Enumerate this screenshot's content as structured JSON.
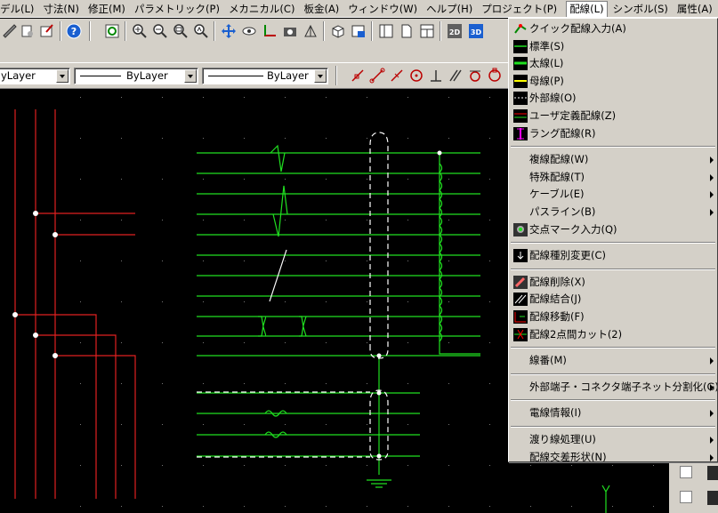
{
  "menubar": {
    "items": [
      {
        "label": "デル(L)"
      },
      {
        "label": "寸法(N)"
      },
      {
        "label": "修正(M)"
      },
      {
        "label": "パラメトリック(P)"
      },
      {
        "label": "メカニカル(C)"
      },
      {
        "label": "板金(A)"
      },
      {
        "label": "ウィンドウ(W)"
      },
      {
        "label": "ヘルプ(H)"
      },
      {
        "label": "プロジェクト(P)"
      },
      {
        "label": "配線(L)"
      },
      {
        "label": "シンボル(S)"
      },
      {
        "label": "属性(A)"
      }
    ]
  },
  "toolbar": {
    "layer_combo": "yLayer",
    "linetype_combo": "ByLayer",
    "lineweight_combo": "ByLayer",
    "btn_2d": "2D",
    "btn_3d": "3D"
  },
  "dropdown": {
    "groups": [
      [
        {
          "label": "クイック配線入力(A)",
          "icon": "quick-wire-icon",
          "submenu": false
        },
        {
          "label": "標準(S)",
          "icon": "standard-wire-icon",
          "submenu": false
        },
        {
          "label": "太線(L)",
          "icon": "thick-wire-icon",
          "submenu": false
        },
        {
          "label": "母線(P)",
          "icon": "bus-wire-icon",
          "submenu": false
        },
        {
          "label": "外部線(O)",
          "icon": "external-wire-icon",
          "submenu": false
        },
        {
          "label": "ユーザ定義配線(Z)",
          "icon": "user-wire-icon",
          "submenu": false
        },
        {
          "label": "ラング配線(R)",
          "icon": "rung-wire-icon",
          "submenu": false
        }
      ],
      [
        {
          "label": "複線配線(W)",
          "icon": "",
          "submenu": true
        },
        {
          "label": "特殊配線(T)",
          "icon": "",
          "submenu": true
        },
        {
          "label": "ケーブル(E)",
          "icon": "",
          "submenu": true
        },
        {
          "label": "パスライン(B)",
          "icon": "",
          "submenu": true
        },
        {
          "label": "交点マーク入力(Q)",
          "icon": "junction-mark-icon",
          "submenu": false
        }
      ],
      [
        {
          "label": "配線種別変更(C)",
          "icon": "wire-type-change-icon",
          "submenu": false
        }
      ],
      [
        {
          "label": "配線削除(X)",
          "icon": "wire-delete-icon",
          "submenu": false
        },
        {
          "label": "配線結合(J)",
          "icon": "wire-join-icon",
          "submenu": false
        },
        {
          "label": "配線移動(F)",
          "icon": "wire-move-icon",
          "submenu": false
        },
        {
          "label": "配線2点間カット(2)",
          "icon": "wire-cut-icon",
          "submenu": false
        }
      ],
      [
        {
          "label": "線番(M)",
          "icon": "",
          "submenu": true
        }
      ],
      [
        {
          "label": "外部端子・コネクタ端子ネット分割化(G)",
          "icon": "",
          "submenu": true
        }
      ],
      [
        {
          "label": "電線情報(I)",
          "icon": "",
          "submenu": true
        }
      ],
      [
        {
          "label": "渡り線処理(U)",
          "icon": "",
          "submenu": true
        },
        {
          "label": "配線交差形状(N)",
          "icon": "",
          "submenu": true
        }
      ]
    ]
  },
  "colors": {
    "menu_bg": "#d4d0c8",
    "canvas_bg": "#000000",
    "wire_red": "#e02020",
    "wire_green": "#20e020",
    "highlight": "#ffffff"
  }
}
